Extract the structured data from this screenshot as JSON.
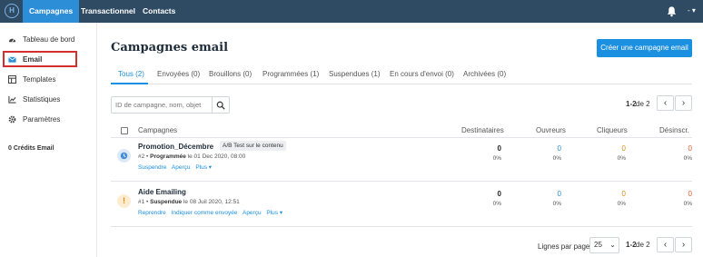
{
  "topbar": {
    "logo": "H",
    "nav": [
      "Campagnes",
      "Transactionnel",
      "Contacts"
    ],
    "user": "- ▾"
  },
  "sidebar": {
    "items": [
      {
        "label": "Tableau de bord",
        "icon": "dashboard-icon"
      },
      {
        "label": "Email",
        "icon": "envelope-icon"
      },
      {
        "label": "Templates",
        "icon": "template-icon"
      },
      {
        "label": "Statistiques",
        "icon": "chart-icon"
      },
      {
        "label": "Paramètres",
        "icon": "gear-icon"
      }
    ],
    "credits": "0 Crédits Email"
  },
  "main": {
    "title": "Campagnes email",
    "create_button": "Créer une campagne email",
    "tabs": [
      "Tous (2)",
      "Envoyées (0)",
      "Brouillons (0)",
      "Programmées (1)",
      "Suspendues (1)",
      "En cours d'envoi (0)",
      "Archivées (0)"
    ],
    "search_placeholder": "ID de campagne, nom, objet",
    "pager": {
      "range": "1-2",
      "of": "de 2"
    },
    "columns": [
      "Campagnes",
      "Destinataires",
      "Ouvreurs",
      "Cliqueurs",
      "Désinscr."
    ],
    "rows": [
      {
        "name": "Promotion_Décembre",
        "tag": "A/B Test sur le contenu",
        "id": "#2 •",
        "status": "Programmée",
        "date": "le 01 Dec 2020, 08:00",
        "actions": [
          "Suspendre",
          "Aperçu",
          "Plus ▾"
        ],
        "stats": [
          {
            "n": "0",
            "p": "0%"
          },
          {
            "n": "0",
            "p": "0%"
          },
          {
            "n": "0",
            "p": "0%"
          },
          {
            "n": "0",
            "p": "0%"
          }
        ],
        "status_icon": "clock-icon",
        "icon_color": "#4a90d9"
      },
      {
        "name": "Aide Emailing",
        "tag": "",
        "id": "#1 •",
        "status": "Suspendue",
        "date": "le 08 Juil 2020, 12:51",
        "actions": [
          "Reprendre",
          "Indiquer comme envoyée",
          "Aperçu",
          "Plus ▾"
        ],
        "stats": [
          {
            "n": "0",
            "p": "0%"
          },
          {
            "n": "0",
            "p": "0%"
          },
          {
            "n": "0",
            "p": "0%"
          },
          {
            "n": "0",
            "p": "0%"
          }
        ],
        "status_icon": "warning-icon",
        "icon_color": "#f0a020"
      }
    ],
    "footer": {
      "per_page_label": "Lignes par page",
      "per_page": "25",
      "range": "1-2",
      "of": "de 2"
    },
    "stat_colors": [
      "#222222",
      "#2d8ed8",
      "#e09020",
      "#e06030"
    ]
  }
}
